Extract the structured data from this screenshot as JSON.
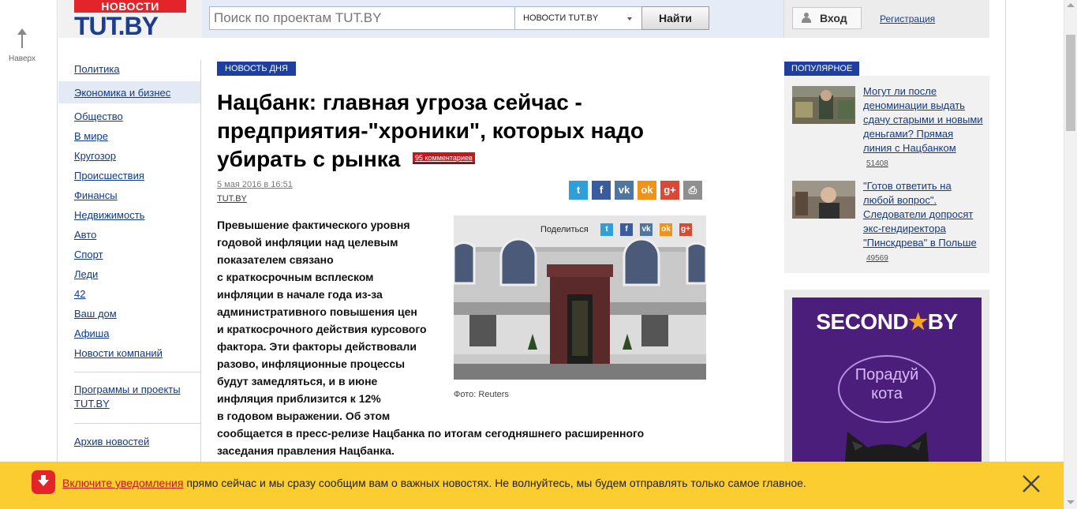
{
  "to_top": {
    "label": "Наверх"
  },
  "logo": {
    "top_label": "НОВОСТИ",
    "main_label": "TUT.BY"
  },
  "search": {
    "placeholder": "Поиск по проектам TUT.BY",
    "scope": "НОВОСТИ TUT.BY",
    "button": "Найти"
  },
  "auth": {
    "login": "Вход",
    "register": "Регистрация"
  },
  "nav": {
    "items": [
      "Политика",
      "Экономика и бизнес",
      "Общество",
      "В мире",
      "Кругозор",
      "Происшествия",
      "Финансы",
      "Недвижимость",
      "Авто",
      "Спорт",
      "Леди",
      "42",
      "Ваш дом",
      "Афиша",
      "Новости компаний"
    ],
    "active_index": 1,
    "programs": "Программы и проекты TUT.BY",
    "archive": "Архив новостей"
  },
  "article": {
    "badge": "НОВОСТЬ ДНЯ",
    "title": "Нацбанк: главная угроза сейчас - предприятия-\"хроники\", которых надо убирать с рынка",
    "comments": "95 комментариев",
    "date": "5 мая 2016 в 16:51",
    "source": "TUT.BY",
    "lead_wrapped": [
      "Превышение фактического уровня",
      "годовой инфляции над целевым",
      "показателем связано",
      "с краткосрочным всплеском",
      "инфляции в начале года из-за",
      "административного повышения цен",
      "и краткосрочного действия курсового",
      "фактора. Эти факторы действовали",
      "разово, инфляционные процессы",
      "будут замедляться, и в июне",
      "инфляция приблизится к 12%",
      "в годовом выражении. Об этом"
    ],
    "lead_full": [
      "сообщается в пресс-релизе Нацбанка по итогам сегодняшнего расширенного",
      "заседания правления Нацбанка."
    ],
    "photo_caption": "Фото: Reuters",
    "photo_share_label": "Поделиться"
  },
  "share_buttons": [
    {
      "name": "twitter",
      "glyph": "t",
      "color": "#2e9fd9"
    },
    {
      "name": "facebook",
      "glyph": "f",
      "color": "#3a5b9d"
    },
    {
      "name": "vk",
      "glyph": "vk",
      "color": "#4e76a3"
    },
    {
      "name": "odnoklassniki",
      "glyph": "ok",
      "color": "#f29318"
    },
    {
      "name": "googleplus",
      "glyph": "g+",
      "color": "#d94a36"
    },
    {
      "name": "print",
      "glyph": "⎙",
      "color": "#8f8f8f"
    }
  ],
  "popular": {
    "badge": "ПОПУЛЯРНОЕ",
    "items": [
      {
        "title": "Могут ли после деноминации выдать сдачу старыми и новыми деньгами? Прямая линия с Нацбанком",
        "count": "51408"
      },
      {
        "title": "\"Готов ответить на любой вопрос\". Следователи допросят экс-гендиректора \"Пинскдрева\" в Польше",
        "count": "49569"
      }
    ]
  },
  "ad": {
    "brand_left": "SECOND",
    "brand_right": "BY",
    "text": "Порадуй кота"
  },
  "notification": {
    "link": "Включите уведомления",
    "text": " прямо сейчас и мы сразу сообщим вам о важных новостях. Не волнуйтесь, мы будем отправлять только самое главное."
  },
  "colors": {
    "accent": "#1f3f9c",
    "brand_red": "#e3242b",
    "notify_bg": "#fccd31"
  }
}
